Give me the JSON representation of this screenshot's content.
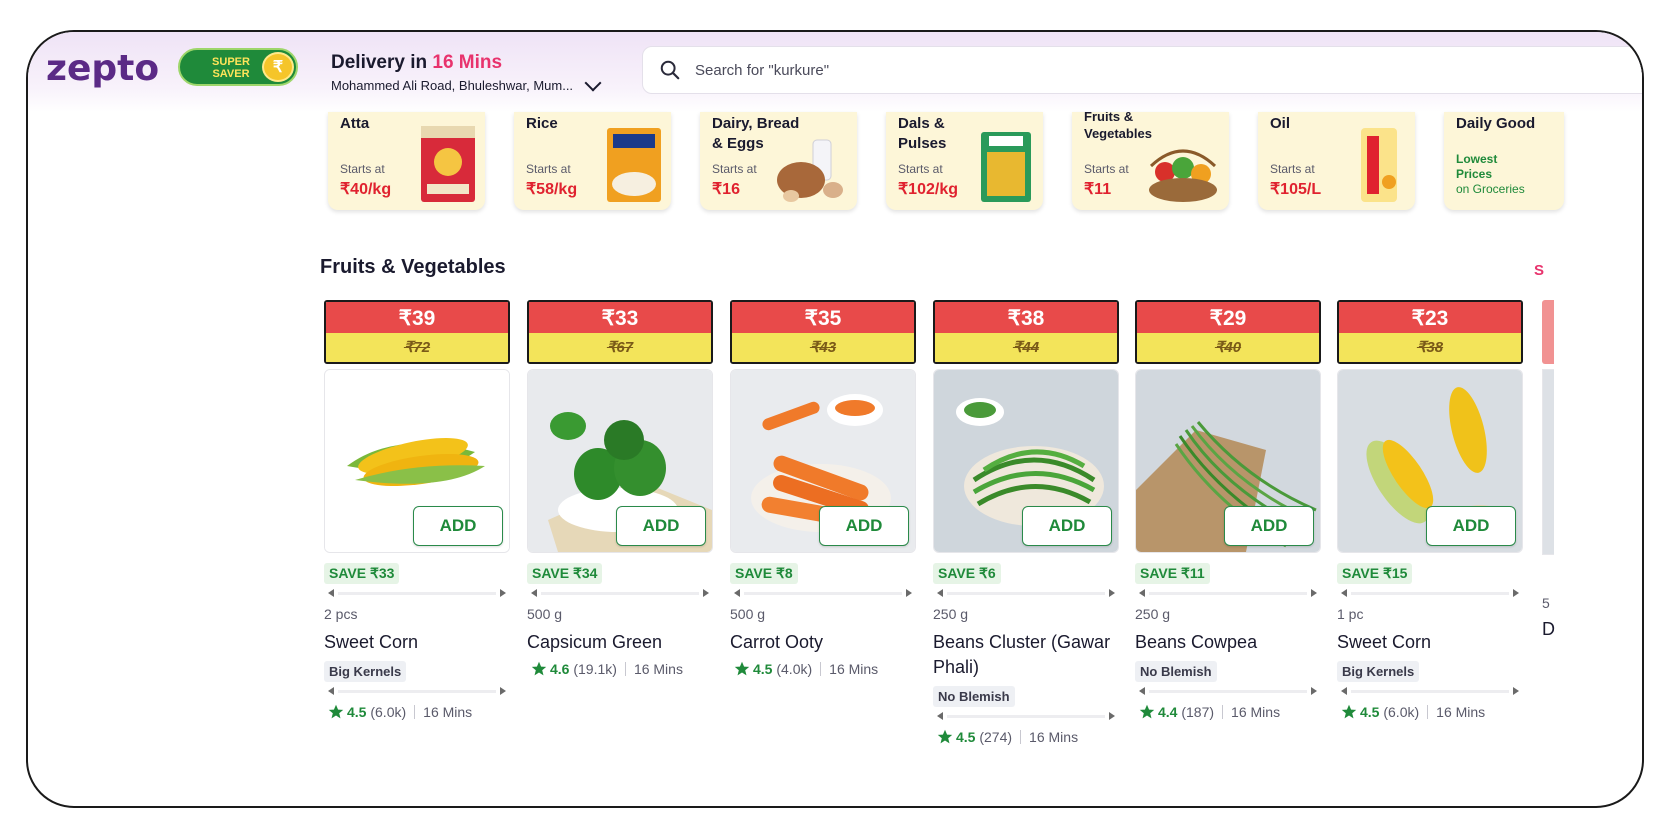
{
  "header": {
    "logo": "zepto",
    "super_saver_line1": "SUPER",
    "super_saver_line2": "SAVER",
    "coin_symbol": "₹",
    "delivery_prefix": "Delivery in",
    "delivery_time": "16 Mins",
    "address": "Mohammed Ali Road, Bhuleshwar, Mum...",
    "search_placeholder": "Search for \"kurkure\""
  },
  "categories": [
    {
      "name": "Atta",
      "starts_label": "Starts at",
      "price": "₹40/kg",
      "img_color": "#d82a3a"
    },
    {
      "name": "Rice",
      "starts_label": "Starts at",
      "price": "₹58/kg",
      "img_color": "#f0a020"
    },
    {
      "name": "Dairy, Bread & Eggs",
      "starts_label": "Starts at",
      "price": "₹16",
      "img_color": "#b06a3a"
    },
    {
      "name": "Dals & Pulses",
      "starts_label": "Starts at",
      "price": "₹102/kg",
      "img_color": "#2a9a5a"
    },
    {
      "name": "Fruits & Vegetables",
      "starts_label": "Starts at",
      "price": "₹11",
      "img_color": "#4aa53a"
    },
    {
      "name": "Oil",
      "starts_label": "Starts at",
      "price": "₹105/L",
      "img_color": "#f0b020"
    },
    {
      "name": "Daily Good",
      "lowest_label": "Lowest Prices",
      "on_groceries": "on Groceries"
    }
  ],
  "section": {
    "title": "Fruits & Vegetables",
    "see_all": "S"
  },
  "add_label": "ADD",
  "products": [
    {
      "price": "₹39",
      "mrp": "₹72",
      "save": "SAVE ₹33",
      "qty": "2 pcs",
      "name": "Sweet Corn",
      "tag": "Big Kernels",
      "rating": "4.5",
      "reviews": "(6.0k)",
      "eta": "16 Mins",
      "img": "corn-white"
    },
    {
      "price": "₹33",
      "mrp": "₹67",
      "save": "SAVE ₹34",
      "qty": "500 g",
      "name": "Capsicum Green",
      "tag": "",
      "rating": "4.6",
      "reviews": "(19.1k)",
      "eta": "16 Mins",
      "img": "capsicum"
    },
    {
      "price": "₹35",
      "mrp": "₹43",
      "save": "SAVE ₹8",
      "qty": "500 g",
      "name": "Carrot Ooty",
      "tag": "",
      "rating": "4.5",
      "reviews": "(4.0k)",
      "eta": "16 Mins",
      "img": "carrot"
    },
    {
      "price": "₹38",
      "mrp": "₹44",
      "save": "SAVE ₹6",
      "qty": "250 g",
      "name": "Beans Cluster (Gawar Phali)",
      "tag": "No Blemish",
      "rating": "4.5",
      "reviews": "(274)",
      "eta": "16 Mins",
      "img": "beans-cluster"
    },
    {
      "price": "₹29",
      "mrp": "₹40",
      "save": "SAVE ₹11",
      "qty": "250 g",
      "name": "Beans Cowpea",
      "tag": "No Blemish",
      "rating": "4.4",
      "reviews": "(187)",
      "eta": "16 Mins",
      "img": "beans-cowpea"
    },
    {
      "price": "₹23",
      "mrp": "₹38",
      "save": "SAVE ₹15",
      "qty": "1 pc",
      "name": "Sweet Corn",
      "tag": "Big Kernels",
      "rating": "4.5",
      "reviews": "(6.0k)",
      "eta": "16 Mins",
      "img": "corn-grey"
    }
  ],
  "partial_card": {
    "qty": "5",
    "name": "D"
  },
  "colors": {
    "brand_purple": "#5b2a86",
    "accent_pink": "#e8336d",
    "price_red": "#e84a4a",
    "mrp_yellow": "#f3e45a",
    "green": "#1f8a3a"
  }
}
